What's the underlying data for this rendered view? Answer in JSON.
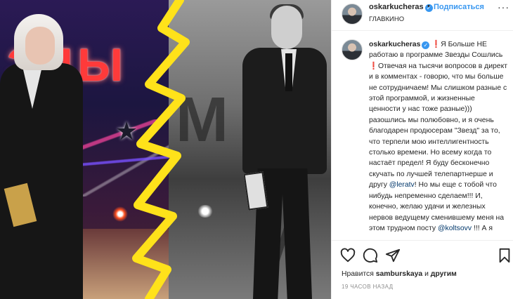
{
  "media": {
    "stage_sign": "ЭДЫ"
  },
  "header": {
    "username": "oskarkucheras",
    "verified_glyph": "✓",
    "separator": "•",
    "follow_label": "Подписаться",
    "location": "ГЛАВКИНО",
    "more_glyph": "···"
  },
  "caption": {
    "username": "oskarkucheras",
    "mark": "❗",
    "part1": "Я Больше НЕ работаю в программе Звезды Сошлись",
    "part2": "Отвечая на тысячи вопросов в директ и в комментах - говорю, что мы больше не сотрудничаем! Мы слишком разные с этой программой, и жизненные ценности у нас тоже разные))) разошлись мы полюбовно, и я очень благодарен продюсерам \"Звезд\" за то, что терпели мою интеллигентность столько времени. Но всему когда то настаёт предел! Я буду бесконечно скучать по лучшей телепартнерше и другу",
    "mention1": "@leratv",
    "part3": "! Но мы еще с тобой что нибудь непременно сделаем!!! И, конечно, желаю удачи и железных нервов ведущему сменившему меня на этом трудном посту",
    "mention2": "@koltsovv",
    "part4": "!!! А я"
  },
  "actions": {
    "like_icon": "heart-icon",
    "comment_icon": "comment-icon",
    "share_icon": "share-icon",
    "save_icon": "bookmark-icon"
  },
  "likes": {
    "prefix": "Нравится",
    "user": "samburskaya",
    "and": "и",
    "others": "другим"
  },
  "timestamp": "19 ЧАСОВ НАЗАД",
  "colors": {
    "accent": "#3897f0",
    "mention": "#00376b",
    "bolt": "#ffe21a"
  }
}
